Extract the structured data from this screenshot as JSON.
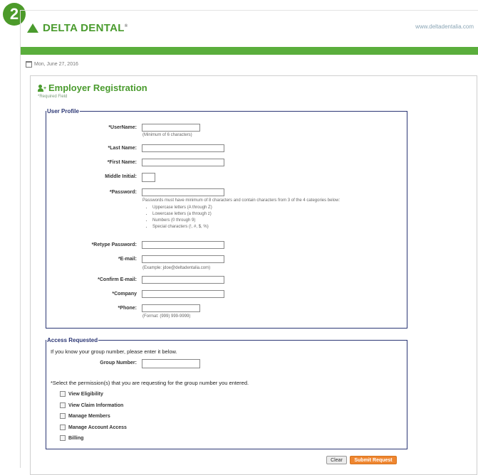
{
  "badge": {
    "number": "2"
  },
  "header": {
    "logo_text": "DELTA DENTAL",
    "logo_mark": "®",
    "site_url": "www.deltadentalia.com",
    "date": "Mon, June 27, 2016"
  },
  "page": {
    "title": "Employer Registration",
    "required_note": "*Required Field"
  },
  "user_profile": {
    "legend": "User Profile",
    "username_label": "*UserName:",
    "username_hint": "(Minimum of 6 characters)",
    "last_name_label": "*Last Name:",
    "first_name_label": "*First Name:",
    "middle_initial_label": "Middle Initial:",
    "password_label": "*Password:",
    "password_rules": "Passwords must have minimum of 8 characters and contain characters from 3 of the 4 categories below:",
    "password_categories": [
      "Uppercase letters (A through Z)",
      "Lowercase letters (a through z)",
      "Numbers (0 through 9)",
      "Special characters (!, #, $, %)"
    ],
    "retype_password_label": "*Retype Password:",
    "email_label": "*E-mail:",
    "email_hint": "(Example: jdoe@deltadentalia.com)",
    "confirm_email_label": "*Confirm E-mail:",
    "company_label": "*Company",
    "phone_label": "*Phone:",
    "phone_hint": "(Format: (999) 999-9999)"
  },
  "access": {
    "legend": "Access Requested",
    "group_hint": "If you know your group number, please enter it below.",
    "group_number_label": "Group Number:",
    "permission_hint": "*Select the permission(s) that you are requesting for the group number you entered.",
    "permissions": [
      "View Eligibility",
      "View Claim Information",
      "Manage Members",
      "Manage Account Access",
      "Billing"
    ]
  },
  "buttons": {
    "clear": "Clear",
    "submit": "Submit Request"
  },
  "colors": {
    "brand_green": "#4a9b2e",
    "bar_green": "#5aae3c",
    "fieldset_border": "#2b3674",
    "submit_orange": "#ef8630"
  }
}
